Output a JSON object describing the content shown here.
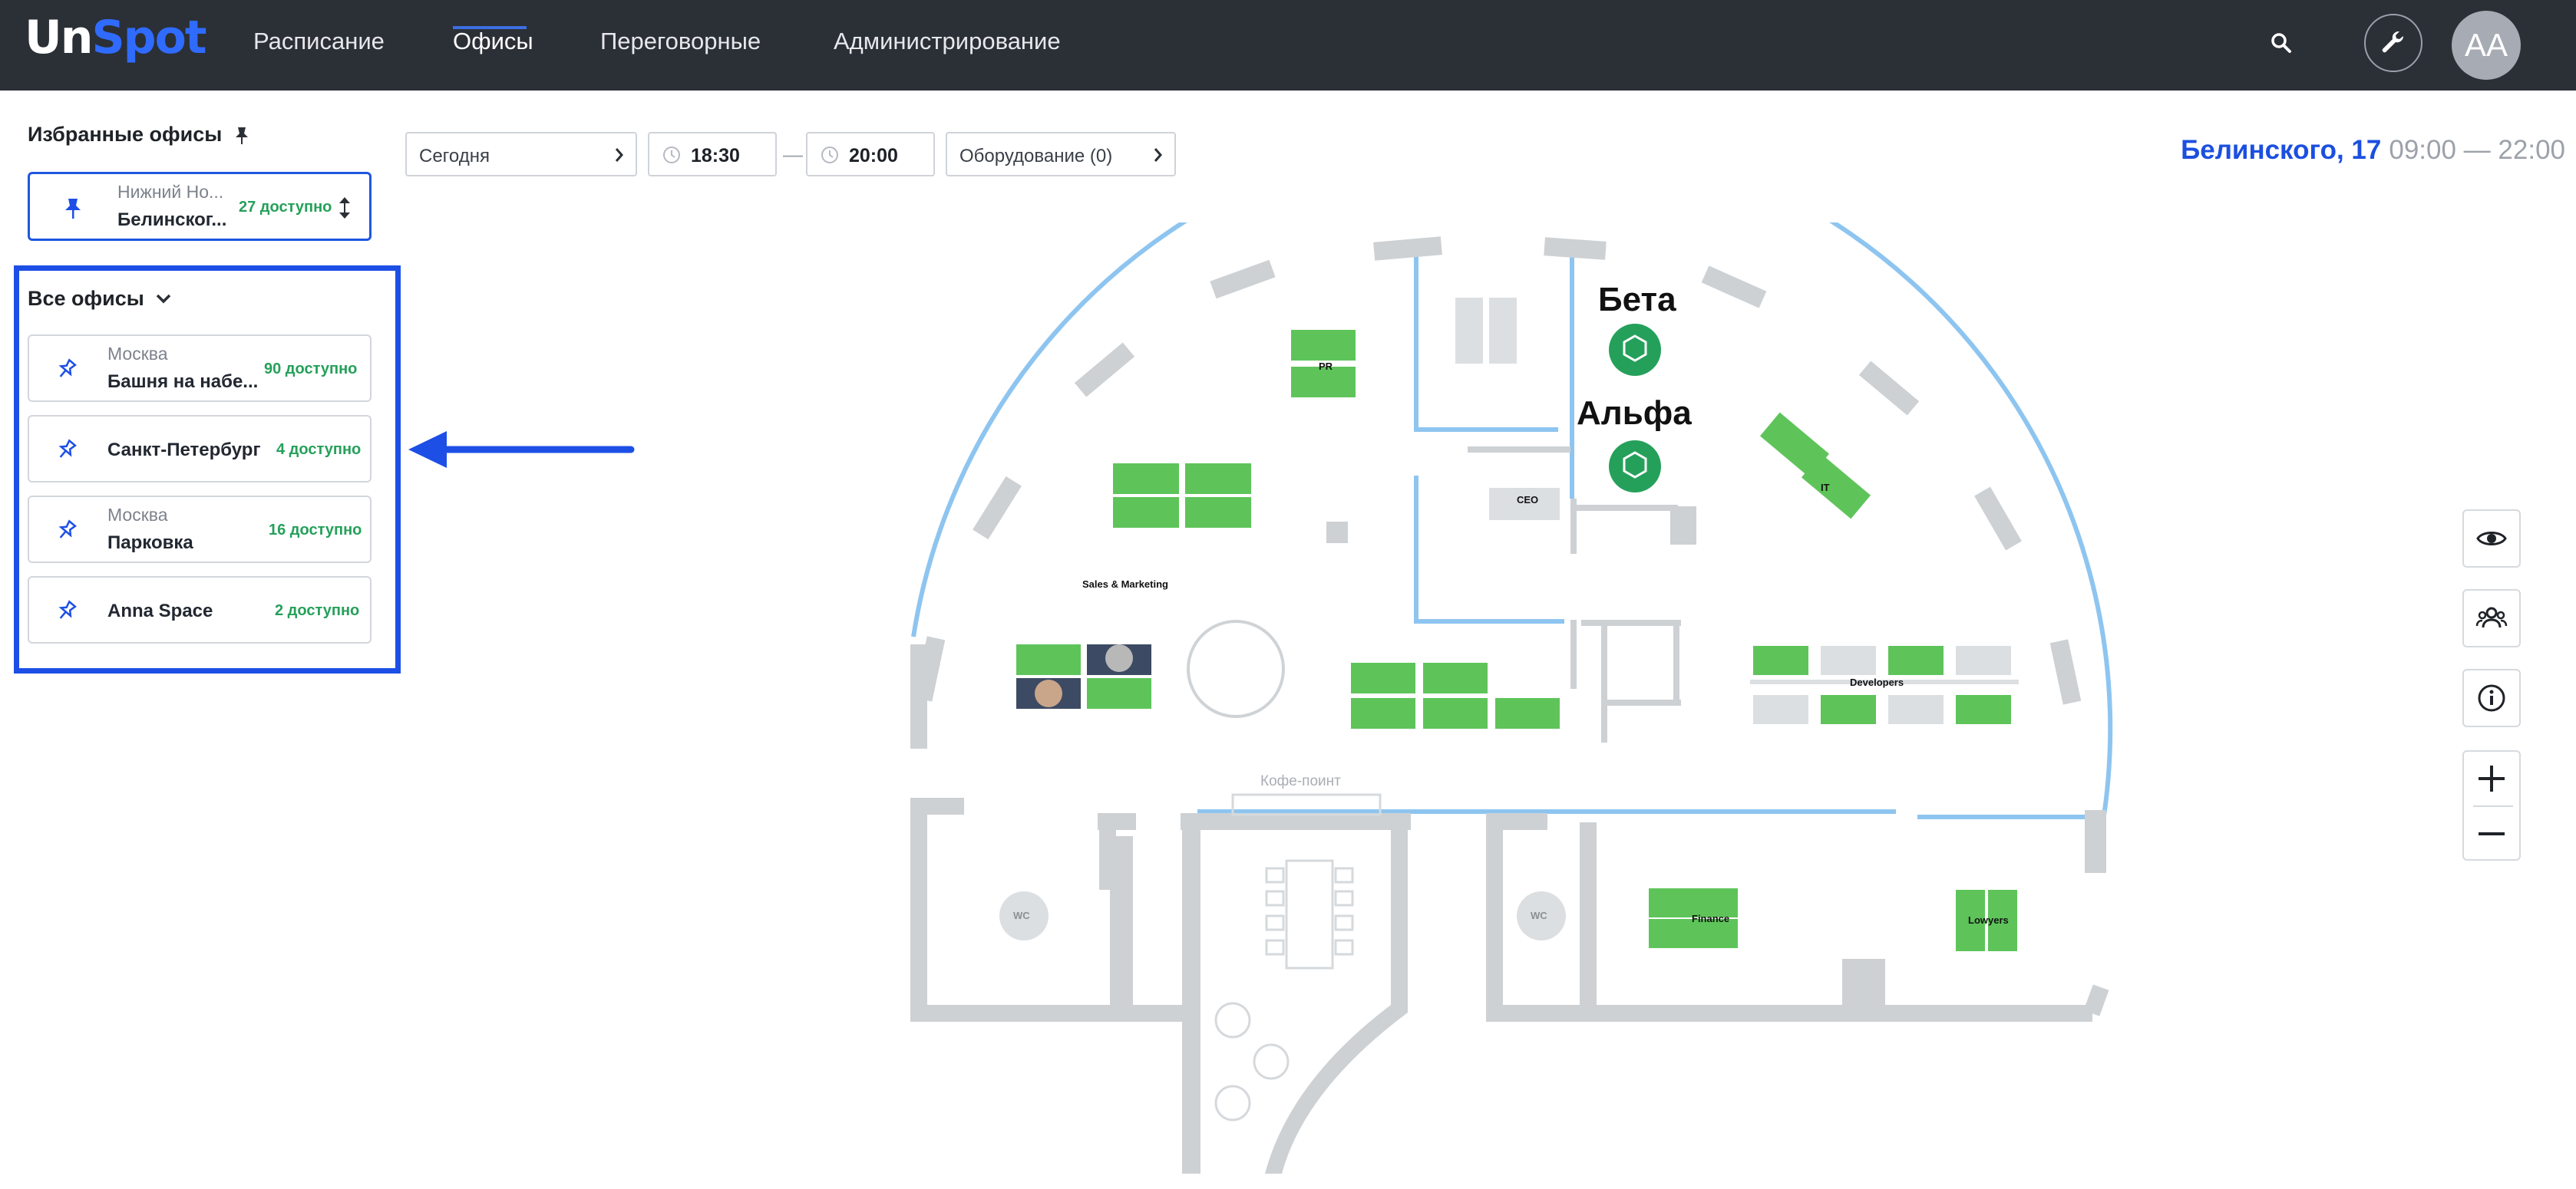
{
  "app": {
    "logo_part1": "Un",
    "logo_part2": "Spot"
  },
  "nav": [
    {
      "label": "Расписание"
    },
    {
      "label": "Офисы"
    },
    {
      "label": "Переговорные"
    },
    {
      "label": "Администрирование"
    }
  ],
  "user": {
    "initials": "AA"
  },
  "favorites": {
    "title": "Избранные офисы",
    "items": [
      {
        "city": "Нижний Но...",
        "name": "Белинског...",
        "availability": "27 доступно"
      }
    ]
  },
  "all_offices": {
    "title": "Все офисы",
    "items": [
      {
        "city": "Москва",
        "name": "Башня на набе...",
        "availability": "90 доступно"
      },
      {
        "city": "",
        "name": "Санкт-Петербург",
        "availability": "4 доступно"
      },
      {
        "city": "Москва",
        "name": "Парковка",
        "availability": "16 доступно"
      },
      {
        "city": "",
        "name": "Anna Space",
        "availability": "2 доступно"
      }
    ]
  },
  "filters": {
    "date": "Сегодня",
    "time_from": "18:30",
    "time_sep": "—",
    "time_to": "20:00",
    "equipment": "Оборудование (0)"
  },
  "office": {
    "name": "Белинского, 17",
    "hours": "09:00 — 22:00"
  },
  "floorplan": {
    "rooms": [
      "Бета",
      "Альфа"
    ],
    "zones": [
      "PR",
      "CEO",
      "IT",
      "Sales & Marketing",
      "Developers",
      "Finance",
      "Lowyers",
      "WC",
      "WC"
    ],
    "coffee_point": "Кофе-поинт"
  },
  "colors": {
    "accent": "#1d4fe6",
    "available": "#25a05a",
    "desk": "#5ec45a",
    "wall": "#cfd3d6",
    "window": "#8ec5f0"
  }
}
